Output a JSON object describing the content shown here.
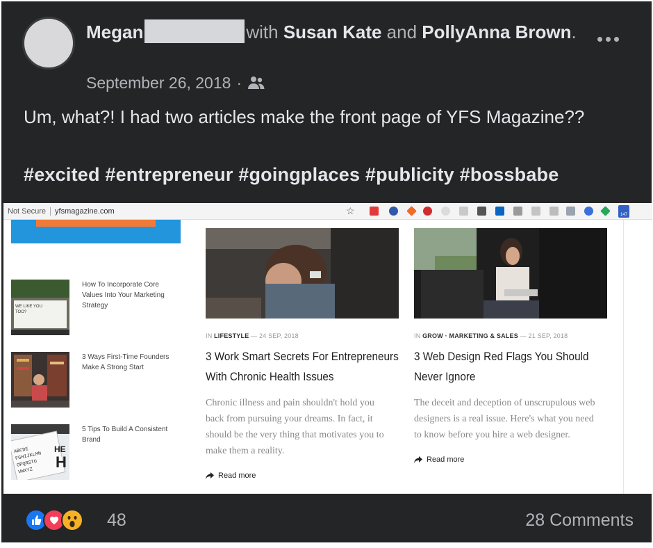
{
  "post": {
    "author_first": "Megan",
    "with_text": "with",
    "tagged_1": "Susan Kate",
    "and_text": "and",
    "tagged_2": "PollyAnna Brown",
    "period": ".",
    "date": "September 26, 2018",
    "dot": "·",
    "audience_icon": "friends-icon",
    "body": "Um, what?! I had two articles make the front page of YFS Magazine??",
    "hashtags": "#excited #entrepreneur #goingplaces #publicity #bossbabe"
  },
  "browser": {
    "security": "Not Secure",
    "url": "yfsmagazine.com",
    "badge": "147"
  },
  "sidebar": {
    "items": [
      {
        "title": "How To Incorporate Core Values Into Your Marketing Strategy",
        "thumb_text": "WE LIKE YOU TOO?"
      },
      {
        "title": "3 Ways First-Time Founders Make A Strong Start"
      },
      {
        "title": "5 Tips To Build A Consistent Brand",
        "thumb_text": "ABCDE FGHIJKLMN OPQRSTU VWXYZ HE H"
      }
    ]
  },
  "articles": [
    {
      "in": "IN",
      "category": "LIFESTYLE",
      "date": "— 24 SEP, 2018",
      "title": "3 Work Smart Secrets For Entrepreneurs With Chronic Health Issues",
      "excerpt": "Chronic illness and pain shouldn't hold you back from pursuing your dreams. In fact, it should be the very thing that motivates you to make them a reality.",
      "read_more": "Read more"
    },
    {
      "in": "IN",
      "category": "GROW · MARKETING & SALES",
      "date": "— 21 SEP, 2018",
      "title": "3 Web Design Red Flags You Should Never Ignore",
      "excerpt": "The deceit and deception of unscrupulous web designers is a real issue. Here's what you need to know before you hire a web designer.",
      "read_more": "Read more"
    }
  ],
  "footer": {
    "reaction_icons": [
      "like-icon",
      "love-icon",
      "wow-icon"
    ],
    "reaction_count": "48",
    "comments": "28 Comments"
  },
  "colors": {
    "post_bg": "#242526",
    "text": "#e4e6eb",
    "muted": "#b0b3b8",
    "like": "#1877f2",
    "love": "#f33e58",
    "wow": "#f7b125"
  }
}
